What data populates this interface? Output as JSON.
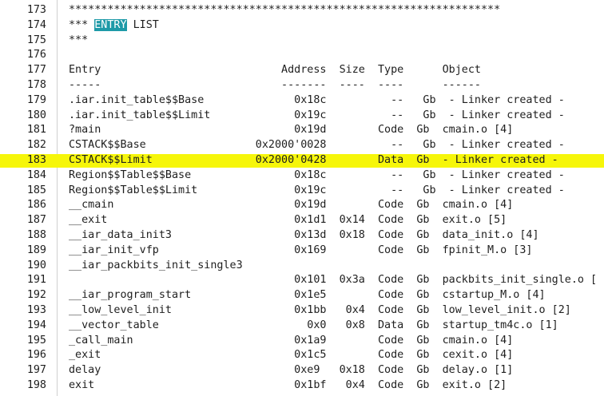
{
  "colors": {
    "highlight": "#f6f60a",
    "selection": "#1e9aa8",
    "text": "#1e1e1e"
  },
  "highlighted_line": 183,
  "selected_word": "ENTRY",
  "lines": [
    {
      "num": "173",
      "pre": "",
      "sel": "",
      "post": "*******************************************************************"
    },
    {
      "num": "174",
      "pre": "*** ",
      "sel": "ENTRY",
      "post": " LIST"
    },
    {
      "num": "175",
      "pre": "",
      "sel": "",
      "post": "***"
    },
    {
      "num": "176",
      "pre": "",
      "sel": "",
      "post": ""
    },
    {
      "num": "177",
      "pre": "",
      "sel": "",
      "post": "Entry                            Address  Size  Type      Object"
    },
    {
      "num": "178",
      "pre": "",
      "sel": "",
      "post": "-----                            -------  ----  ----      ------"
    },
    {
      "num": "179",
      "pre": "",
      "sel": "",
      "post": ".iar.init_table$$Base              0x18c          --   Gb  - Linker created -"
    },
    {
      "num": "180",
      "pre": "",
      "sel": "",
      "post": ".iar.init_table$$Limit             0x19c          --   Gb  - Linker created -"
    },
    {
      "num": "181",
      "pre": "",
      "sel": "",
      "post": "?main                              0x19d        Code  Gb  cmain.o [4]"
    },
    {
      "num": "182",
      "pre": "",
      "sel": "",
      "post": "CSTACK$$Base                 0x2000'0028          --   Gb  - Linker created -"
    },
    {
      "num": "183",
      "pre": "",
      "sel": "",
      "post": "CSTACK$$Limit                0x2000'0428        Data  Gb  - Linker created -"
    },
    {
      "num": "184",
      "pre": "",
      "sel": "",
      "post": "Region$$Table$$Base                0x18c          --   Gb  - Linker created -"
    },
    {
      "num": "185",
      "pre": "",
      "sel": "",
      "post": "Region$$Table$$Limit               0x19c          --   Gb  - Linker created -"
    },
    {
      "num": "186",
      "pre": "",
      "sel": "",
      "post": "__cmain                            0x19d        Code  Gb  cmain.o [4]"
    },
    {
      "num": "187",
      "pre": "",
      "sel": "",
      "post": "__exit                             0x1d1  0x14  Code  Gb  exit.o [5]"
    },
    {
      "num": "188",
      "pre": "",
      "sel": "",
      "post": "__iar_data_init3                   0x13d  0x18  Code  Gb  data_init.o [4]"
    },
    {
      "num": "189",
      "pre": "",
      "sel": "",
      "post": "__iar_init_vfp                     0x169        Code  Gb  fpinit_M.o [3]"
    },
    {
      "num": "190",
      "pre": "",
      "sel": "",
      "post": "__iar_packbits_init_single3"
    },
    {
      "num": "191",
      "pre": "",
      "sel": "",
      "post": "                                   0x101  0x3a  Code  Gb  packbits_init_single.o ["
    },
    {
      "num": "192",
      "pre": "",
      "sel": "",
      "post": "__iar_program_start                0x1e5        Code  Gb  cstartup_M.o [4]"
    },
    {
      "num": "193",
      "pre": "",
      "sel": "",
      "post": "__low_level_init                   0x1bb   0x4  Code  Gb  low_level_init.o [2]"
    },
    {
      "num": "194",
      "pre": "",
      "sel": "",
      "post": "__vector_table                       0x0   0x8  Data  Gb  startup_tm4c.o [1]"
    },
    {
      "num": "195",
      "pre": "",
      "sel": "",
      "post": "_call_main                         0x1a9        Code  Gb  cmain.o [4]"
    },
    {
      "num": "196",
      "pre": "",
      "sel": "",
      "post": "_exit                              0x1c5        Code  Gb  cexit.o [4]"
    },
    {
      "num": "197",
      "pre": "",
      "sel": "",
      "post": "delay                              0xe9   0x18  Code  Gb  delay.o [1]"
    },
    {
      "num": "198",
      "pre": "",
      "sel": "",
      "post": "exit                               0x1bf   0x4  Code  Gb  exit.o [2]"
    }
  ]
}
